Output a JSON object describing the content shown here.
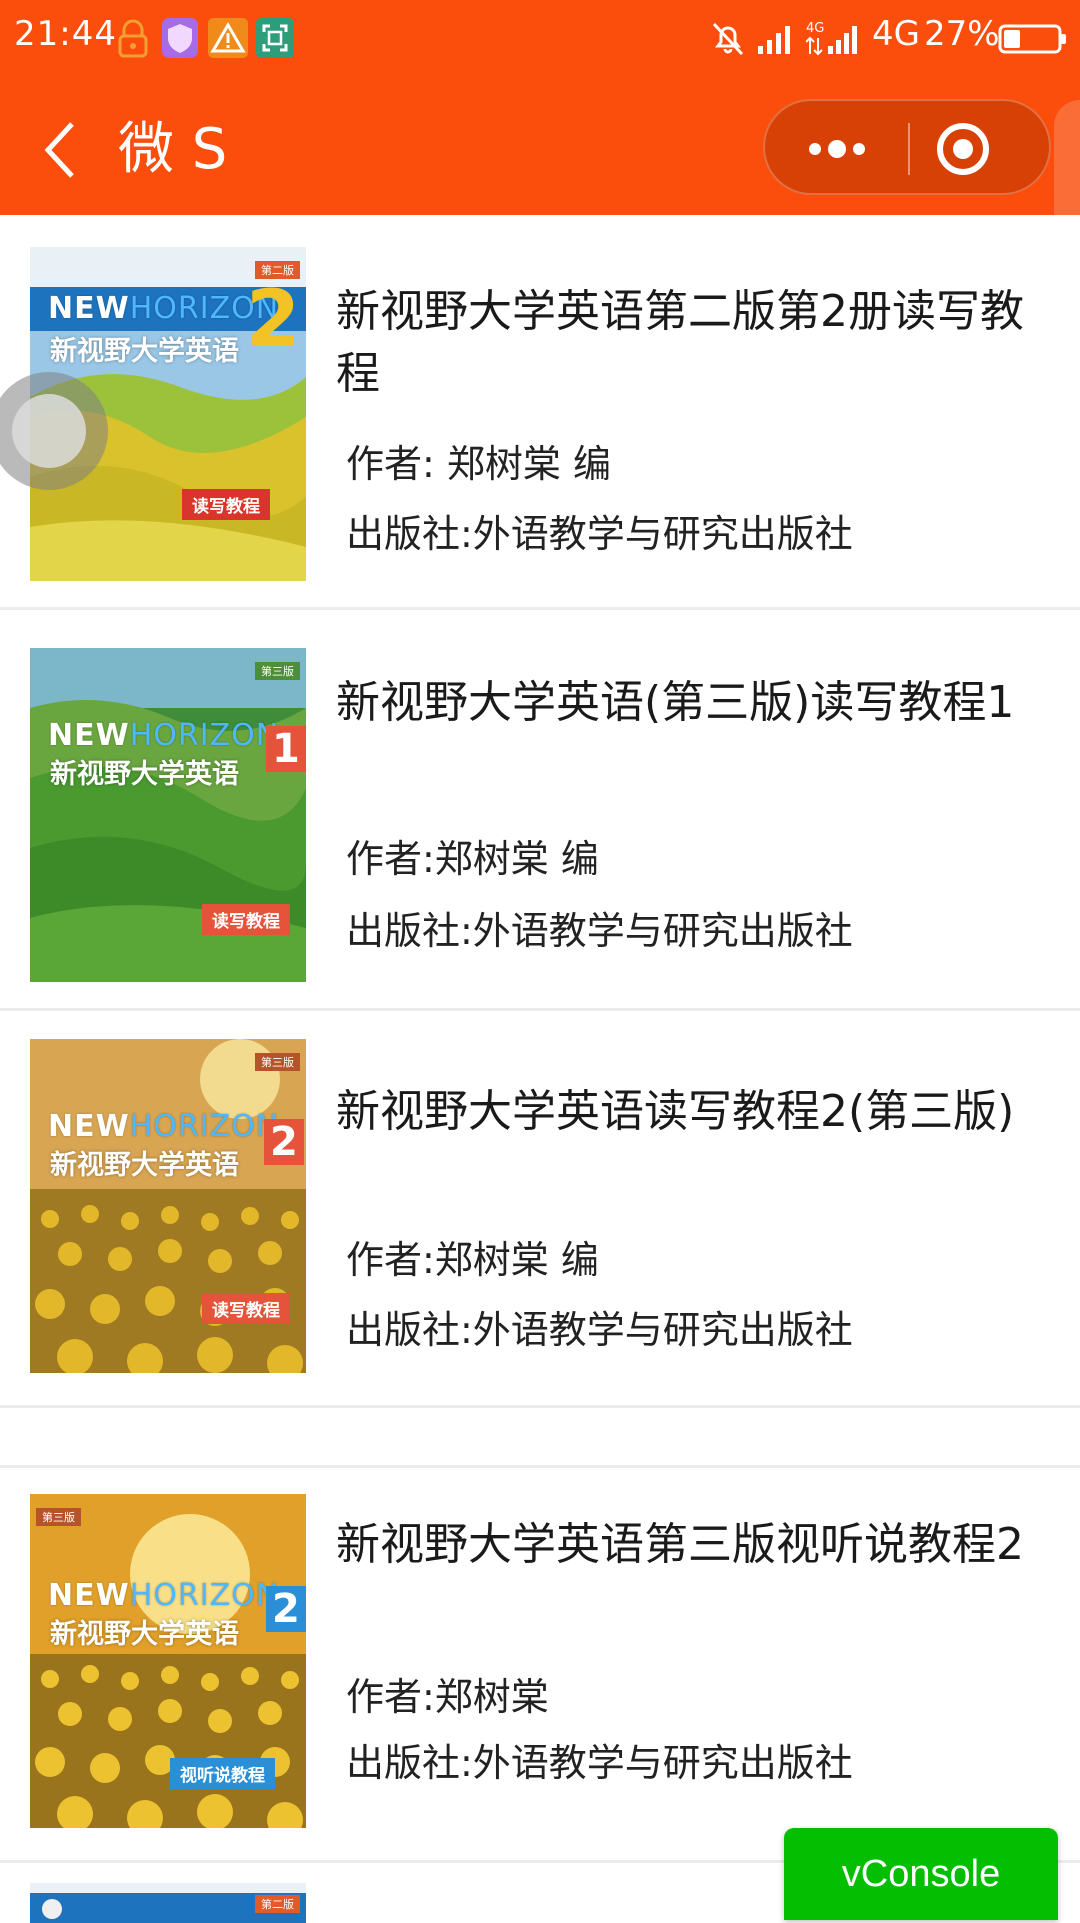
{
  "status_bar": {
    "time": "21:44",
    "network": "4G",
    "battery": "27%",
    "icons": [
      "lock-icon",
      "shield-icon",
      "warning-icon",
      "scan-icon",
      "bell-off-icon",
      "signal-icon",
      "signal-4g-icon",
      "battery-icon"
    ]
  },
  "nav": {
    "title": "微 S",
    "back_icon": "chevron-left-icon",
    "more_icon": "more-dots-icon",
    "close_icon": "target-circle-icon"
  },
  "books": [
    {
      "title": "新视野大学英语第二版第2册读写教程",
      "author": "作者:  郑树棠 编",
      "publisher": "出版社:外语教学与研究出版社",
      "cover": {
        "edition": "第二版",
        "number": "2",
        "tag": "读写教程"
      }
    },
    {
      "title": "新视野大学英语(第三版)读写教程1",
      "author": "作者:郑树棠 编",
      "publisher": "出版社:外语教学与研究出版社",
      "cover": {
        "edition": "第三版",
        "number": "1",
        "tag": "读写教程"
      }
    },
    {
      "title": "新视野大学英语读写教程2(第三版)",
      "author": "作者:郑树棠 编",
      "publisher": "出版社:外语教学与研究出版社",
      "cover": {
        "edition": "第三版",
        "number": "2",
        "tag": "读写教程"
      }
    },
    {
      "title": "新视野大学英语第三版视听说教程2",
      "author": "作者:郑树棠",
      "publisher": "出版社:外语教学与研究出版社",
      "cover": {
        "edition": "第三版",
        "number": "2",
        "tag": "视听说教程"
      }
    },
    {
      "cover": {
        "edition": "第二版"
      }
    }
  ],
  "cover_brand": {
    "logo_a": "NEW",
    "logo_b": "HORIZON",
    "name": "新视野大学英语"
  },
  "vconsole_label": "vConsole"
}
